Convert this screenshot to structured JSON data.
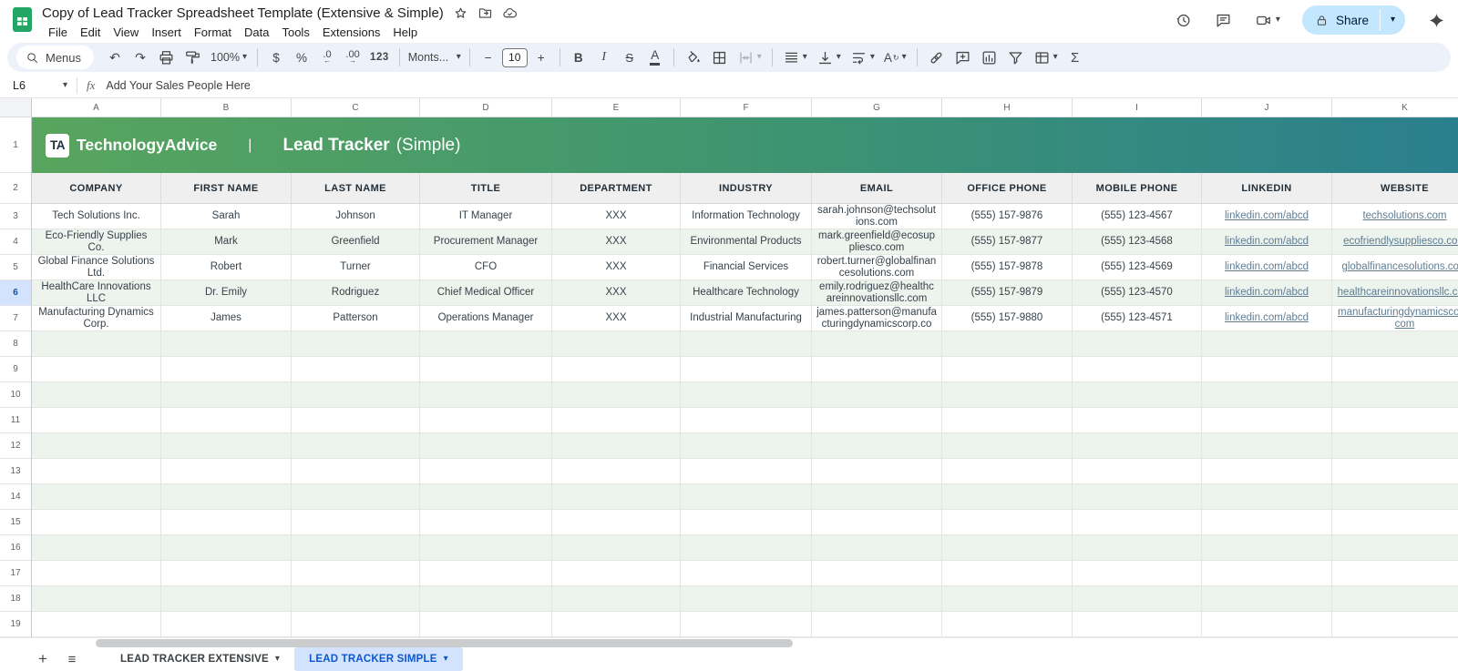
{
  "titlebar": {
    "title": "Copy of Lead Tracker Spreadsheet Template (Extensive & Simple)",
    "share_label": "Share"
  },
  "menubar": {
    "items": [
      "File",
      "Edit",
      "View",
      "Insert",
      "Format",
      "Data",
      "Tools",
      "Extensions",
      "Help"
    ]
  },
  "toolbar": {
    "menus_label": "Menus",
    "zoom": "100%",
    "currency": "$",
    "percent": "%",
    "decrease_decimals": ".0",
    "decrease_arrow": "←",
    "increase_decimals": ".00",
    "increase_arrow": "→",
    "number_format": "123",
    "font_name": "Monts...",
    "font_size": "10",
    "minus": "−",
    "plus": "+",
    "bold": "B",
    "italic": "I",
    "strikethrough": "S",
    "text_color": "A",
    "rotate_label": "A",
    "rotate_arrow": "↻",
    "functions": "Σ"
  },
  "formula_bar": {
    "cell_ref": "L6",
    "fx_label": "fx",
    "content": "Add Your Sales People Here"
  },
  "banner": {
    "logo_text": "TA",
    "brand": "TechnologyAdvice",
    "divider": "|",
    "title": "Lead Tracker",
    "subtitle": "(Simple)"
  },
  "grid": {
    "column_letters": [
      "A",
      "B",
      "C",
      "D",
      "E",
      "F",
      "G",
      "H",
      "I",
      "J",
      "K"
    ],
    "headers": [
      "COMPANY",
      "FIRST NAME",
      "LAST NAME",
      "TITLE",
      "DEPARTMENT",
      "INDUSTRY",
      "EMAIL",
      "OFFICE PHONE",
      "MOBILE PHONE",
      "LINKEDIN",
      "WEBSITE"
    ],
    "rows": [
      [
        "Tech Solutions Inc.",
        "Sarah",
        "Johnson",
        "IT Manager",
        "XXX",
        "Information Technology",
        "sarah.johnson@techsolutions.com",
        "(555) 157-9876",
        "(555) 123-4567",
        "linkedin.com/abcd",
        "techsolutions.com"
      ],
      [
        "Eco-Friendly Supplies Co.",
        "Mark",
        "Greenfield",
        "Procurement Manager",
        "XXX",
        "Environmental Products",
        "mark.greenfield@ecosuppliesco.com",
        "(555) 157-9877",
        "(555) 123-4568",
        "linkedin.com/abcd",
        "ecofriendlysuppliesco.com"
      ],
      [
        "Global Finance Solutions Ltd.",
        "Robert",
        "Turner",
        "CFO",
        "XXX",
        "Financial Services",
        "robert.turner@globalfinancesolutions.com",
        "(555) 157-9878",
        "(555) 123-4569",
        "linkedin.com/abcd",
        "globalfinancesolutions.com"
      ],
      [
        "HealthCare Innovations LLC",
        "Dr. Emily",
        "Rodriguez",
        "Chief Medical Officer",
        "XXX",
        "Healthcare Technology",
        "emily.rodriguez@healthcareinnovationsllc.com",
        "(555) 157-9879",
        "(555) 123-4570",
        "linkedin.com/abcd",
        "healthcareinnovationsllc.com"
      ],
      [
        "Manufacturing Dynamics Corp.",
        "James",
        "Patterson",
        "Operations Manager",
        "XXX",
        "Industrial Manufacturing",
        "james.patterson@manufacturingdynamicscorp.co",
        "(555) 157-9880",
        "(555) 123-4571",
        "linkedin.com/abcd",
        "manufacturingdynamicscorp.com"
      ]
    ],
    "first_data_row": 3,
    "last_row": 19,
    "selected_row": 6
  },
  "sheet_tabs": {
    "tabs": [
      {
        "label": "LEAD TRACKER EXTENSIVE",
        "active": false
      },
      {
        "label": "LEAD TRACKER SIMPLE",
        "active": true
      }
    ]
  },
  "icons": {
    "undo": "↶",
    "redo": "↷",
    "caret-down": "▾",
    "sum": "Σ",
    "add-sheet": "+",
    "all-sheets": "≡",
    "search": "magnifier-svg",
    "print": "printer-svg",
    "paint-format": "roller-svg",
    "fill-color": "bucket-svg",
    "borders": "grid-svg",
    "merge-cells": "merge-svg",
    "horizontal-align": "lines-svg",
    "vertical-align": "arrow-to-line-svg",
    "text-wrap": "wrap-arrow-svg",
    "insert-link": "chain-svg",
    "insert-comment": "bubble-plus-svg",
    "insert-chart": "bar-chart-svg",
    "create-filter": "funnel-svg",
    "table-views": "table-grid-svg",
    "version-history": "clock-arrow-svg",
    "comments": "speech-bubble-svg",
    "meet": "camera-svg",
    "lock": "padlock-svg",
    "gemini": "four-point-star-svg",
    "star": "star-outline-svg",
    "move-folder": "folder-arrow-svg",
    "cloud-saved": "cloud-check-svg"
  },
  "colors": {
    "banner_gradient_start": "#58a55e",
    "banner_gradient_end": "#2a7f8e",
    "header_row_bg": "#efefef",
    "row_alt_green": "#edf3ed",
    "link": "#5e7d93",
    "selected_row_bg": "#d3e3fd",
    "active_tab_bg": "#d3e3fd",
    "active_tab_text": "#0b57d0",
    "share_bg": "#c2e7ff",
    "toolbar_bg": "#edf2fa"
  }
}
